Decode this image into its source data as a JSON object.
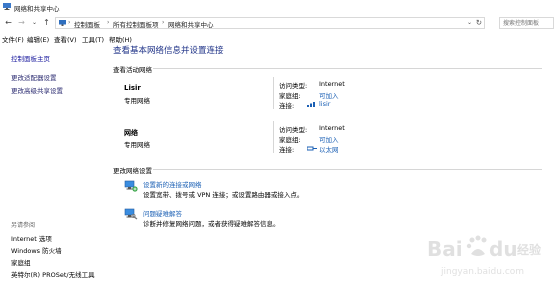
{
  "window": {
    "title": "网络和共享中心"
  },
  "address": {
    "crumbs": [
      "控制面板",
      "所有控制面板项",
      "网络和共享中心"
    ],
    "search_placeholder": "搜索控制面板"
  },
  "menu": [
    "文件(F)",
    "编辑(E)",
    "查看(V)",
    "工具(T)",
    "帮助(H)"
  ],
  "left": {
    "home": "控制面板主页",
    "links": [
      "更改适配器设置",
      "更改高级共享设置"
    ],
    "see_also": "另请参阅",
    "bottom_links": [
      "Internet 选项",
      "Windows 防火墙",
      "家庭组",
      "英特尔(R) PROSet/无线工具"
    ]
  },
  "main": {
    "title": "查看基本网络信息并设置连接",
    "active_section": "查看活动网络",
    "networks": [
      {
        "name": "Lisir",
        "type": "专用网络",
        "access_label": "访问类型:",
        "access_value": "Internet",
        "homegroup_label": "家庭组:",
        "homegroup_value": "可加入",
        "connection_label": "连接:",
        "connection_value": "lisir"
      },
      {
        "name": "网络",
        "type": "专用网络",
        "access_label": "访问类型:",
        "access_value": "Internet",
        "homegroup_label": "家庭组:",
        "homegroup_value": "可加入",
        "connection_label": "连接:",
        "connection_value": "以太网"
      }
    ],
    "change_section": "更改网络设置",
    "tasks": [
      {
        "link": "设置新的连接或网络",
        "desc": "设置宽带、拨号或 VPN 连接；或设置路由器或接入点。"
      },
      {
        "link": "问题疑难解答",
        "desc": "诊断并修复网络问题，或者获得疑难解答信息。"
      }
    ]
  },
  "colors": {
    "link": "#1a5fb4",
    "title": "#1e3287",
    "divider": "#d6d6d6"
  }
}
